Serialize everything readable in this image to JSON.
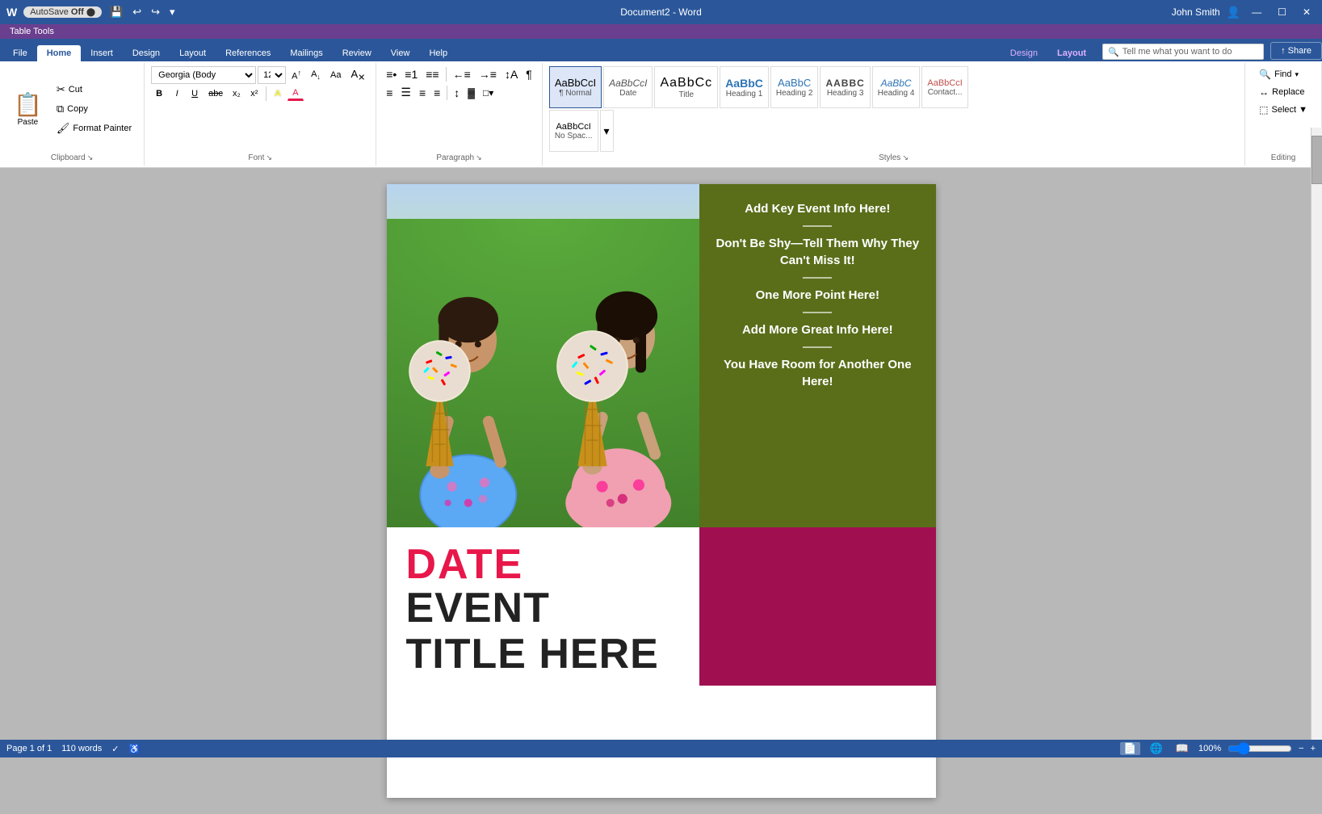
{
  "titleBar": {
    "autoSave": "AutoSave",
    "autoSaveState": "Off",
    "docTitle": "Document2 - Word",
    "userName": "John Smith",
    "windowBtns": [
      "—",
      "☐",
      "✕"
    ]
  },
  "ribbon": {
    "tableToolsLabel": "Table Tools",
    "tabs": [
      "File",
      "Home",
      "Insert",
      "Design",
      "Layout",
      "References",
      "Mailings",
      "Review",
      "View",
      "Help"
    ],
    "activeTab": "Home",
    "contextualTabs": [
      "Design",
      "Layout"
    ],
    "activeContextualTab": "Layout",
    "clipboard": {
      "label": "Clipboard",
      "paste": "Paste",
      "cut": "Cut",
      "copy": "Copy",
      "formatPainter": "Format Painter"
    },
    "font": {
      "label": "Font",
      "name": "Georgia (Body",
      "size": "12",
      "growBtn": "A↑",
      "shrinkBtn": "A↓",
      "caseBtn": "Aa",
      "clearBtn": "A",
      "bold": "B",
      "italic": "I",
      "underline": "U",
      "strikethrough": "abc",
      "subscript": "x₂",
      "superscript": "x²",
      "textHighlight": "A",
      "fontColor": "A"
    },
    "paragraph": {
      "label": "Paragraph",
      "bullets": "≡•",
      "numbering": "≡1",
      "multilevel": "≡≡",
      "decreaseIndent": "←≡",
      "increaseIndent": "→≡",
      "sort": "↕A",
      "showHide": "¶",
      "alignLeft": "≡",
      "alignCenter": "☰",
      "alignRight": "≡",
      "justify": "≡",
      "lineSpacing": "↕",
      "shading": "▓",
      "borders": "□"
    },
    "styles": {
      "label": "Styles",
      "items": [
        {
          "name": "Normal",
          "label": "¶ Normal",
          "preview": "AaBbCcI"
        },
        {
          "name": "Date",
          "label": "Date",
          "preview": "AaBbCcI"
        },
        {
          "name": "Title",
          "label": "Title",
          "preview": "AaBbCc"
        },
        {
          "name": "Heading1",
          "label": "Heading 1",
          "preview": "AaBbC"
        },
        {
          "name": "Heading2",
          "label": "Heading 2",
          "preview": "AaBbC"
        },
        {
          "name": "Heading3",
          "label": "Heading 3",
          "preview": "AABBC"
        },
        {
          "name": "Heading4",
          "label": "Heading 4",
          "preview": "AaBbC"
        },
        {
          "name": "Contact",
          "label": "Contact...",
          "preview": "AaBbCcI"
        },
        {
          "name": "NoSpacing",
          "label": "No Spac...",
          "preview": "AaBbCcI"
        }
      ]
    },
    "editing": {
      "label": "Editing",
      "find": "Find",
      "replace": "Replace",
      "select": "Select ▼"
    }
  },
  "document": {
    "infoPanel": {
      "backgroundColor": "#5a6e1a",
      "items": [
        {
          "text": "Add Key Event Info Here!"
        },
        {
          "text": "Don't Be Shy—Tell Them Why They Can't Miss It!"
        },
        {
          "text": "One More Point Here!"
        },
        {
          "text": "Add More Great Info Here!"
        },
        {
          "text": "You Have Room for Another One Here!"
        }
      ]
    },
    "bottomSection": {
      "dateText": "DATE",
      "eventText": "EVENT",
      "titleText": "TITLE HERE"
    }
  },
  "statusBar": {
    "page": "Page 1 of 1",
    "words": "110 words",
    "views": [
      "📄",
      "📋",
      "👁"
    ],
    "zoom": "100%",
    "zoomSlider": 100
  }
}
